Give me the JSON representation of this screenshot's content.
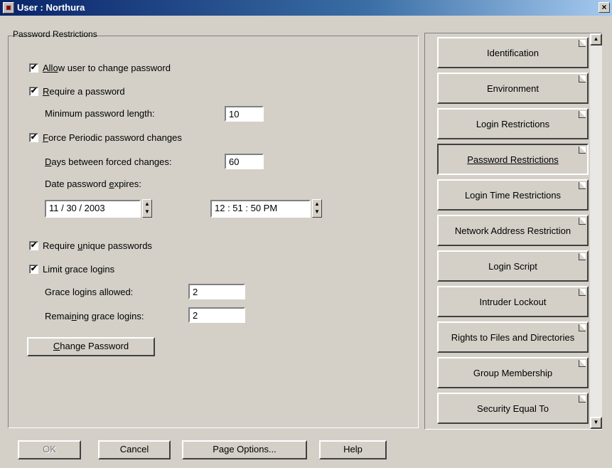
{
  "window": {
    "title": "User : Northura",
    "icon": "user-icon",
    "close": "×"
  },
  "group": {
    "label": "Password Restrictions"
  },
  "options": {
    "allow_change": {
      "label_u": "Allo",
      "label": "w user to change password",
      "checked": true
    },
    "require_password": {
      "label_u": "R",
      "label": "equire a password",
      "checked": true
    },
    "min_length": {
      "label": "Minimum password length:",
      "value": "10"
    },
    "force_periodic": {
      "label_u": "F",
      "label": "orce Periodic password changes",
      "checked": true
    },
    "days_between": {
      "label_u": "D",
      "label": "ays between forced changes:",
      "value": "60"
    },
    "expires_label_pre": "Date password ",
    "expires_label_u": "e",
    "expires_label_post": "xpires:",
    "expires_date": "11 / 30 / 2003",
    "expires_time": "12 : 51 : 50 PM",
    "require_unique": {
      "label_pre": "Require ",
      "label_u": "u",
      "label": "nique passwords",
      "checked": true
    },
    "limit_grace": {
      "label_pre": "Limit ",
      "label_u": "g",
      "label": "race logins",
      "checked": true
    },
    "grace_allowed": {
      "label": "Grace logins allowed:",
      "value": "2"
    },
    "grace_remaining": {
      "label_pre": "Remai",
      "label_u": "n",
      "label": "ing grace logins:",
      "value": "2"
    },
    "change_password": {
      "label_u": "C",
      "label": "hange Password"
    }
  },
  "pages": [
    {
      "label": "Identification"
    },
    {
      "label": "Environment"
    },
    {
      "label": "Login Restrictions"
    },
    {
      "label": "Password Restrictions",
      "active": true
    },
    {
      "label": "Login Time Restrictions"
    },
    {
      "label": "Network Address Restriction"
    },
    {
      "label": "Login Script"
    },
    {
      "label": "Intruder Lockout"
    },
    {
      "label": "Rights to Files and Directories"
    },
    {
      "label": "Group Membership"
    },
    {
      "label": "Security Equal To"
    }
  ],
  "footer": {
    "ok": "OK",
    "cancel": "Cancel",
    "page_options": "Page Options...",
    "help": "Help"
  },
  "check_mark": "✔"
}
